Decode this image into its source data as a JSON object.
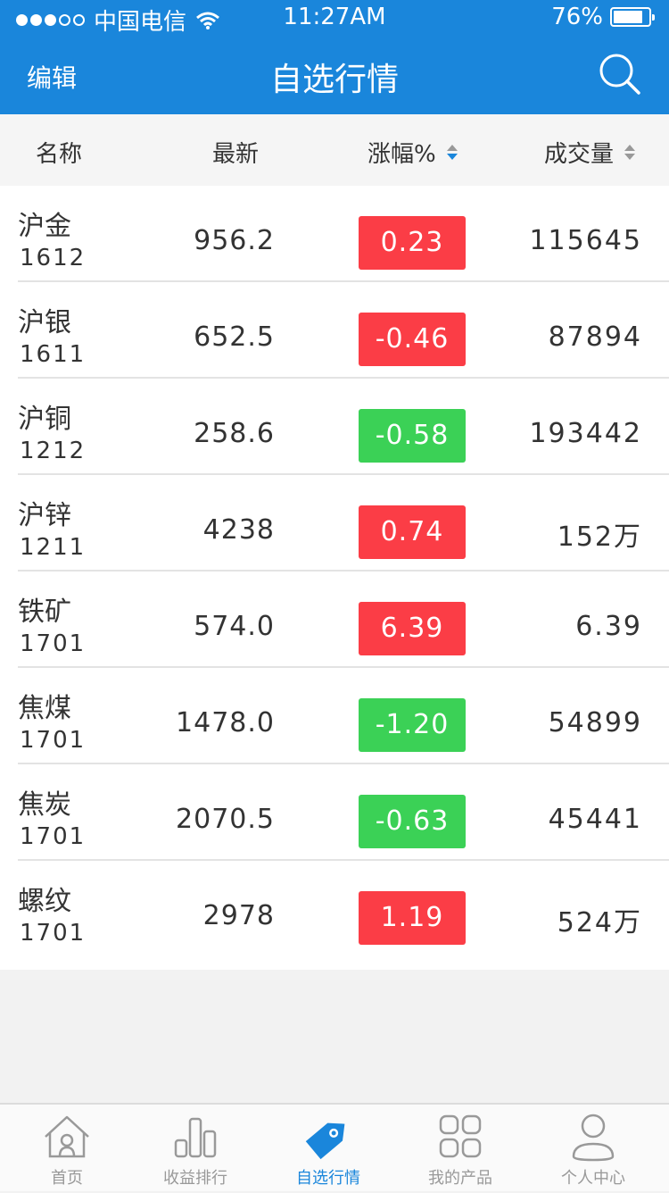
{
  "status_bar": {
    "carrier": "中国电信",
    "time": "11:27AM",
    "battery": "76%",
    "battery_level": 0.76
  },
  "nav": {
    "edit_label": "编辑",
    "title": "自选行情",
    "search_icon": "search-icon"
  },
  "table_header": {
    "name": "名称",
    "latest": "最新",
    "change": "涨幅%",
    "volume": "成交量"
  },
  "rows": [
    {
      "name": "沪金",
      "code": "1612",
      "price": "956.2",
      "change": "0.23",
      "direction": "up",
      "volume": "115645"
    },
    {
      "name": "沪银",
      "code": "1611",
      "price": "652.5",
      "change": "-0.46",
      "direction": "up",
      "volume": "87894"
    },
    {
      "name": "沪铜",
      "code": "1212",
      "price": "258.6",
      "change": "-0.58",
      "direction": "down",
      "volume": "193442"
    },
    {
      "name": "沪锌",
      "code": "1211",
      "price": "4238",
      "change": "0.74",
      "direction": "up",
      "volume": "152万"
    },
    {
      "name": "铁矿",
      "code": "1701",
      "price": "574.0",
      "change": "6.39",
      "direction": "up",
      "volume": "6.39"
    },
    {
      "name": "焦煤",
      "code": "1701",
      "price": "1478.0",
      "change": "-1.20",
      "direction": "down",
      "volume": "54899"
    },
    {
      "name": "焦炭",
      "code": "1701",
      "price": "2070.5",
      "change": "-0.63",
      "direction": "down",
      "volume": "45441"
    },
    {
      "name": "螺纹",
      "code": "1701",
      "price": "2978",
      "change": "1.19",
      "direction": "up",
      "volume": "524万"
    }
  ],
  "tabs": [
    {
      "label": "首页",
      "icon": "home-icon"
    },
    {
      "label": "收益排行",
      "icon": "bar-chart-icon"
    },
    {
      "label": "自选行情",
      "icon": "tag-icon",
      "active": true
    },
    {
      "label": "我的产品",
      "icon": "grid-icon"
    },
    {
      "label": "个人中心",
      "icon": "user-icon"
    }
  ],
  "colors": {
    "primary": "#1a86db",
    "up": "#fb3d46",
    "down": "#3bd156"
  }
}
